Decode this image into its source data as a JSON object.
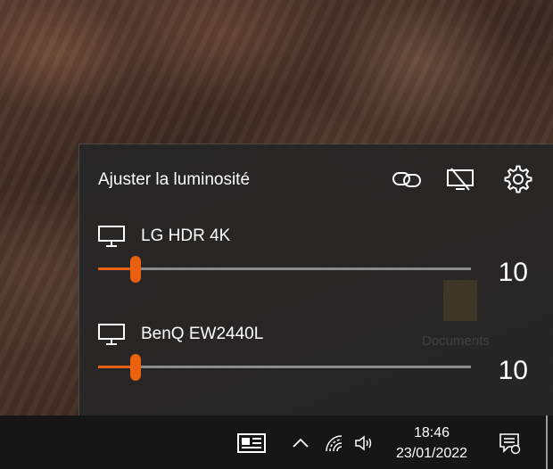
{
  "flyout": {
    "title": "Ajuster la luminosité",
    "header_icons": [
      "link-icon",
      "display-off-icon",
      "gear-icon"
    ],
    "background_ghost_text": "Documents",
    "monitors": [
      {
        "name": "LG HDR 4K",
        "brightness": 10,
        "brightness_label": "10"
      },
      {
        "name": "BenQ EW2440L",
        "brightness": 10,
        "brightness_label": "10"
      }
    ]
  },
  "taskbar": {
    "time": "18:46",
    "date": "23/01/2022",
    "icons": [
      "news-icon",
      "chevron-up-icon",
      "wifi-icon",
      "volume-icon",
      "notification-icon"
    ]
  },
  "colors": {
    "accent": "#e9600f",
    "track": "#8c8c8c",
    "flyout_bg": "#262626",
    "taskbar_bg": "#161616"
  }
}
